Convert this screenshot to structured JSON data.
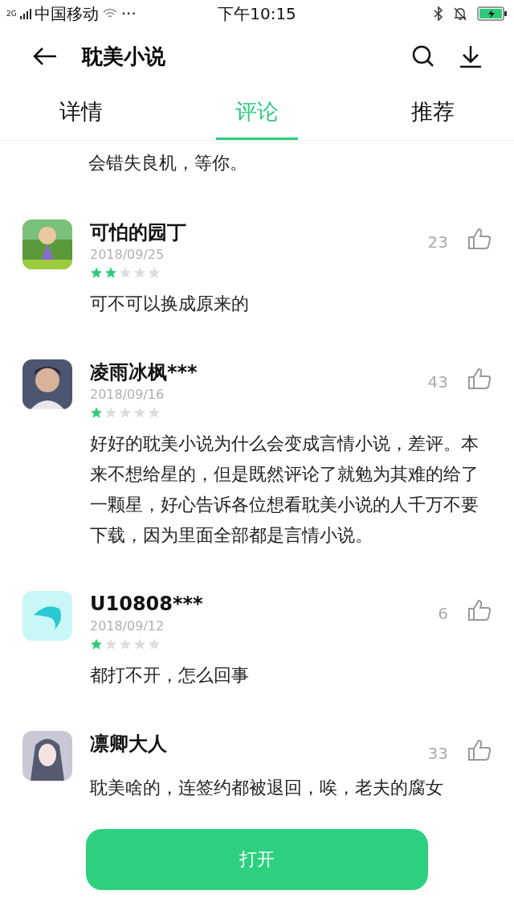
{
  "status_bar": {
    "network": "2G",
    "carrier": "中国移动",
    "more": "···",
    "time": "下午10:15"
  },
  "header": {
    "title": "耽美小说"
  },
  "tabs": [
    {
      "label": "详情",
      "selected": false
    },
    {
      "label": "评论",
      "selected": true
    },
    {
      "label": "推荐",
      "selected": false
    }
  ],
  "partial_text": "会错失良机，等你。",
  "reviews": [
    {
      "user": "可怕的园丁",
      "date": "2018/09/25",
      "stars": 2,
      "likes": "23",
      "text": "可不可以换成原来的"
    },
    {
      "user": "凌雨冰枫***",
      "date": "2018/09/16",
      "stars": 1,
      "likes": "43",
      "text": "好好的耽美小说为什么会变成言情小说，差评。本来不想给星的，但是既然评论了就勉为其难的给了一颗星，好心告诉各位想看耽美小说的人千万不要下载，因为里面全部都是言情小说。"
    },
    {
      "user": "U10808***",
      "date": "2018/09/12",
      "stars": 1,
      "likes": "6",
      "text": "都打不开，怎么回事"
    },
    {
      "user": "凛卿大人",
      "likes": "33",
      "text": "耽美啥的，连签约都被退回，唉，老夫的腐女"
    }
  ],
  "open_button": "打开"
}
